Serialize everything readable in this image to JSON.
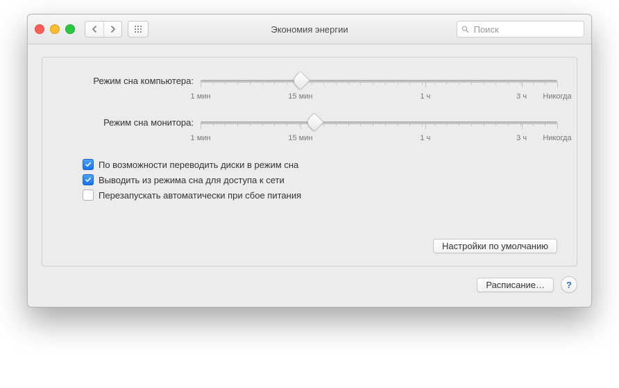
{
  "window": {
    "title": "Экономия энергии"
  },
  "toolbar": {
    "search_placeholder": "Поиск"
  },
  "sliders": {
    "computer": {
      "label": "Режим сна компьютера:",
      "position_pct": 28,
      "ticks": {
        "t1": "1 мин",
        "t2": "15 мин",
        "t3": "1 ч",
        "t4": "3 ч",
        "t5": "Никогда"
      }
    },
    "display": {
      "label": "Режим сна монитора:",
      "position_pct": 32,
      "ticks": {
        "t1": "1 мин",
        "t2": "15 мин",
        "t3": "1 ч",
        "t4": "3 ч",
        "t5": "Никогда"
      }
    }
  },
  "checks": {
    "disks": {
      "label": "По возможности переводить диски в режим сна",
      "checked": true
    },
    "wake": {
      "label": "Выводить из режима сна для доступа к сети",
      "checked": true
    },
    "restart": {
      "label": "Перезапускать автоматически при сбое питания",
      "checked": false
    }
  },
  "buttons": {
    "defaults": "Настройки по умолчанию",
    "schedule": "Расписание…"
  },
  "help": "?"
}
